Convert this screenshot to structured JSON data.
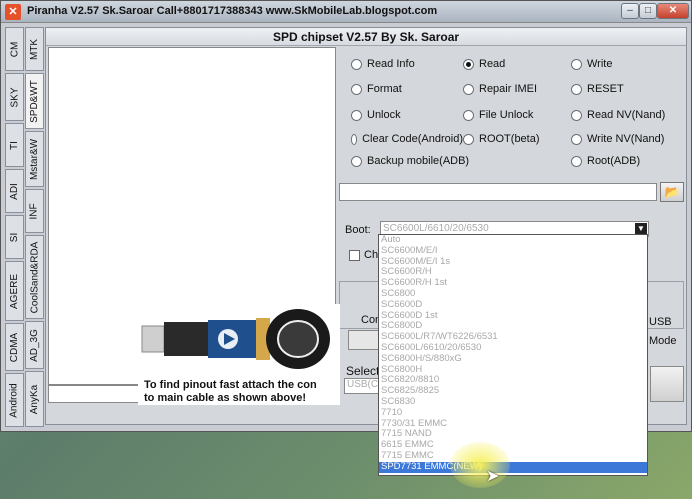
{
  "window": {
    "title": "Piranha V2.57 Sk.Saroar  Call+8801717388343 www.SkMobileLab.blogspot.com",
    "min_label": "–",
    "max_label": "□",
    "close_label": "✕"
  },
  "vtabs": [
    "CM",
    "MTK",
    "SKY",
    "SPD&WT",
    "TI",
    "Mstar&W",
    "ADI",
    "INF",
    "SI",
    "CoolSand&RDA",
    "AGERE",
    "AD_3G",
    "CDMA",
    "AnyKa",
    "Android"
  ],
  "panel": {
    "title": "SPD chipset V2.57 By Sk. Saroar"
  },
  "radios": {
    "read_info": "Read Info",
    "read": "Read",
    "write": "Write",
    "format": "Format",
    "repair_imei": "Repair IMEI",
    "reset": "RESET",
    "unlock": "Unlock",
    "file_unlock": "File Unlock",
    "read_nv": "Read NV(Nand)",
    "clear_code": "Clear Code(Android)",
    "root_beta": "ROOT(beta)",
    "write_nv": "Write NV(Nand)",
    "backup_mobile": "Backup mobile(ADB)",
    "root_adb": "Root(ADB)"
  },
  "boot": {
    "label": "Boot:",
    "value": "SC6600L/6610/20/6530"
  },
  "check_label": "Cha",
  "con_label": "Con",
  "usb_label": "USB",
  "mode_label": "Mode",
  "select_label": "Select",
  "usb_field": "USB(C",
  "dropdown_items": [
    "Auto",
    "SC6600M/E/I",
    "SC6600M/E/I 1s",
    "SC6600R/H",
    "SC6600R/H 1st",
    "SC6800",
    "SC6600D",
    "SC6600D 1st",
    "SC6800D",
    "SC6600L/R7/WT6226/6531",
    "SC6600L/6610/20/6530",
    "SC6800H/S/880xG",
    "SC6800H",
    "SC6820/8810",
    "SC6825/8825",
    "SC6830",
    "7710",
    "7730/31 EMMC",
    "7715 NAND",
    "6615 EMMC",
    "7715 EMMC",
    "SPD7731 EMMC(NEW)"
  ],
  "selected_index": 21,
  "pinout": {
    "line1": "To find pinout fast attach the con",
    "line2": "to main cable as shown above!"
  }
}
